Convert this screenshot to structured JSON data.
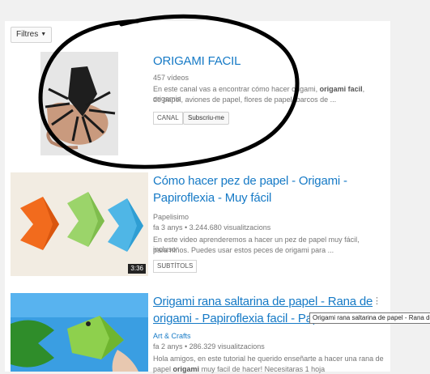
{
  "filters": {
    "label": "Filtres"
  },
  "results": [
    {
      "kind": "channel",
      "title": "ORIGAMI FACIL",
      "video_count": "457 vídeos",
      "desc_1": "En este canal vas a encontrar cómo hacer origami,",
      "desc_bold_1": "origami facil",
      "desc_tail_1": ", origamis",
      "desc_2": "de papel, aviones de papel, flores de papel, barcos de ...",
      "badge": "CANAL",
      "subscribe": "Subscriu-me"
    },
    {
      "kind": "video",
      "title_1": "Cómo hacer pez de papel - Origami -",
      "title_2": "Papiroflexia - Muy fácil",
      "channel": "Papelisimo",
      "stats": "fa 3 anys • 3.244.680 visualitzacions",
      "desc_1": "En este video aprenderemos a hacer un pez de papel muy fácil, incluso",
      "desc_2": "para niños. Puedes usar estos peces de origami para ...",
      "badge": "SUBTÍTOLS",
      "duration": "3:36"
    },
    {
      "kind": "video",
      "title_1": "Origami rana saltarina de papel - Rana de",
      "title_2": "origami - Papiroflexia facil - Paper fr",
      "channel": "Art & Crafts",
      "stats": "fa 2 anys • 286.329 visualitzacions",
      "desc_1": "Hola amigos, en este tutorial he querido enseñarte a hacer una rana de",
      "desc_2_pre": "papel",
      "desc_2_bold": "origami",
      "desc_2_post": "muy facil de hacer! Necesitaras 1 hoja"
    }
  ],
  "tooltip": "Origami rana saltarina de papel - Rana de origami",
  "colors": {
    "link_blue": "#167ac6",
    "annotation_circle": "#000000",
    "fish_orange": "#f26b1d",
    "fish_green": "#9bd46a",
    "fish_blue": "#4fb6e6"
  }
}
